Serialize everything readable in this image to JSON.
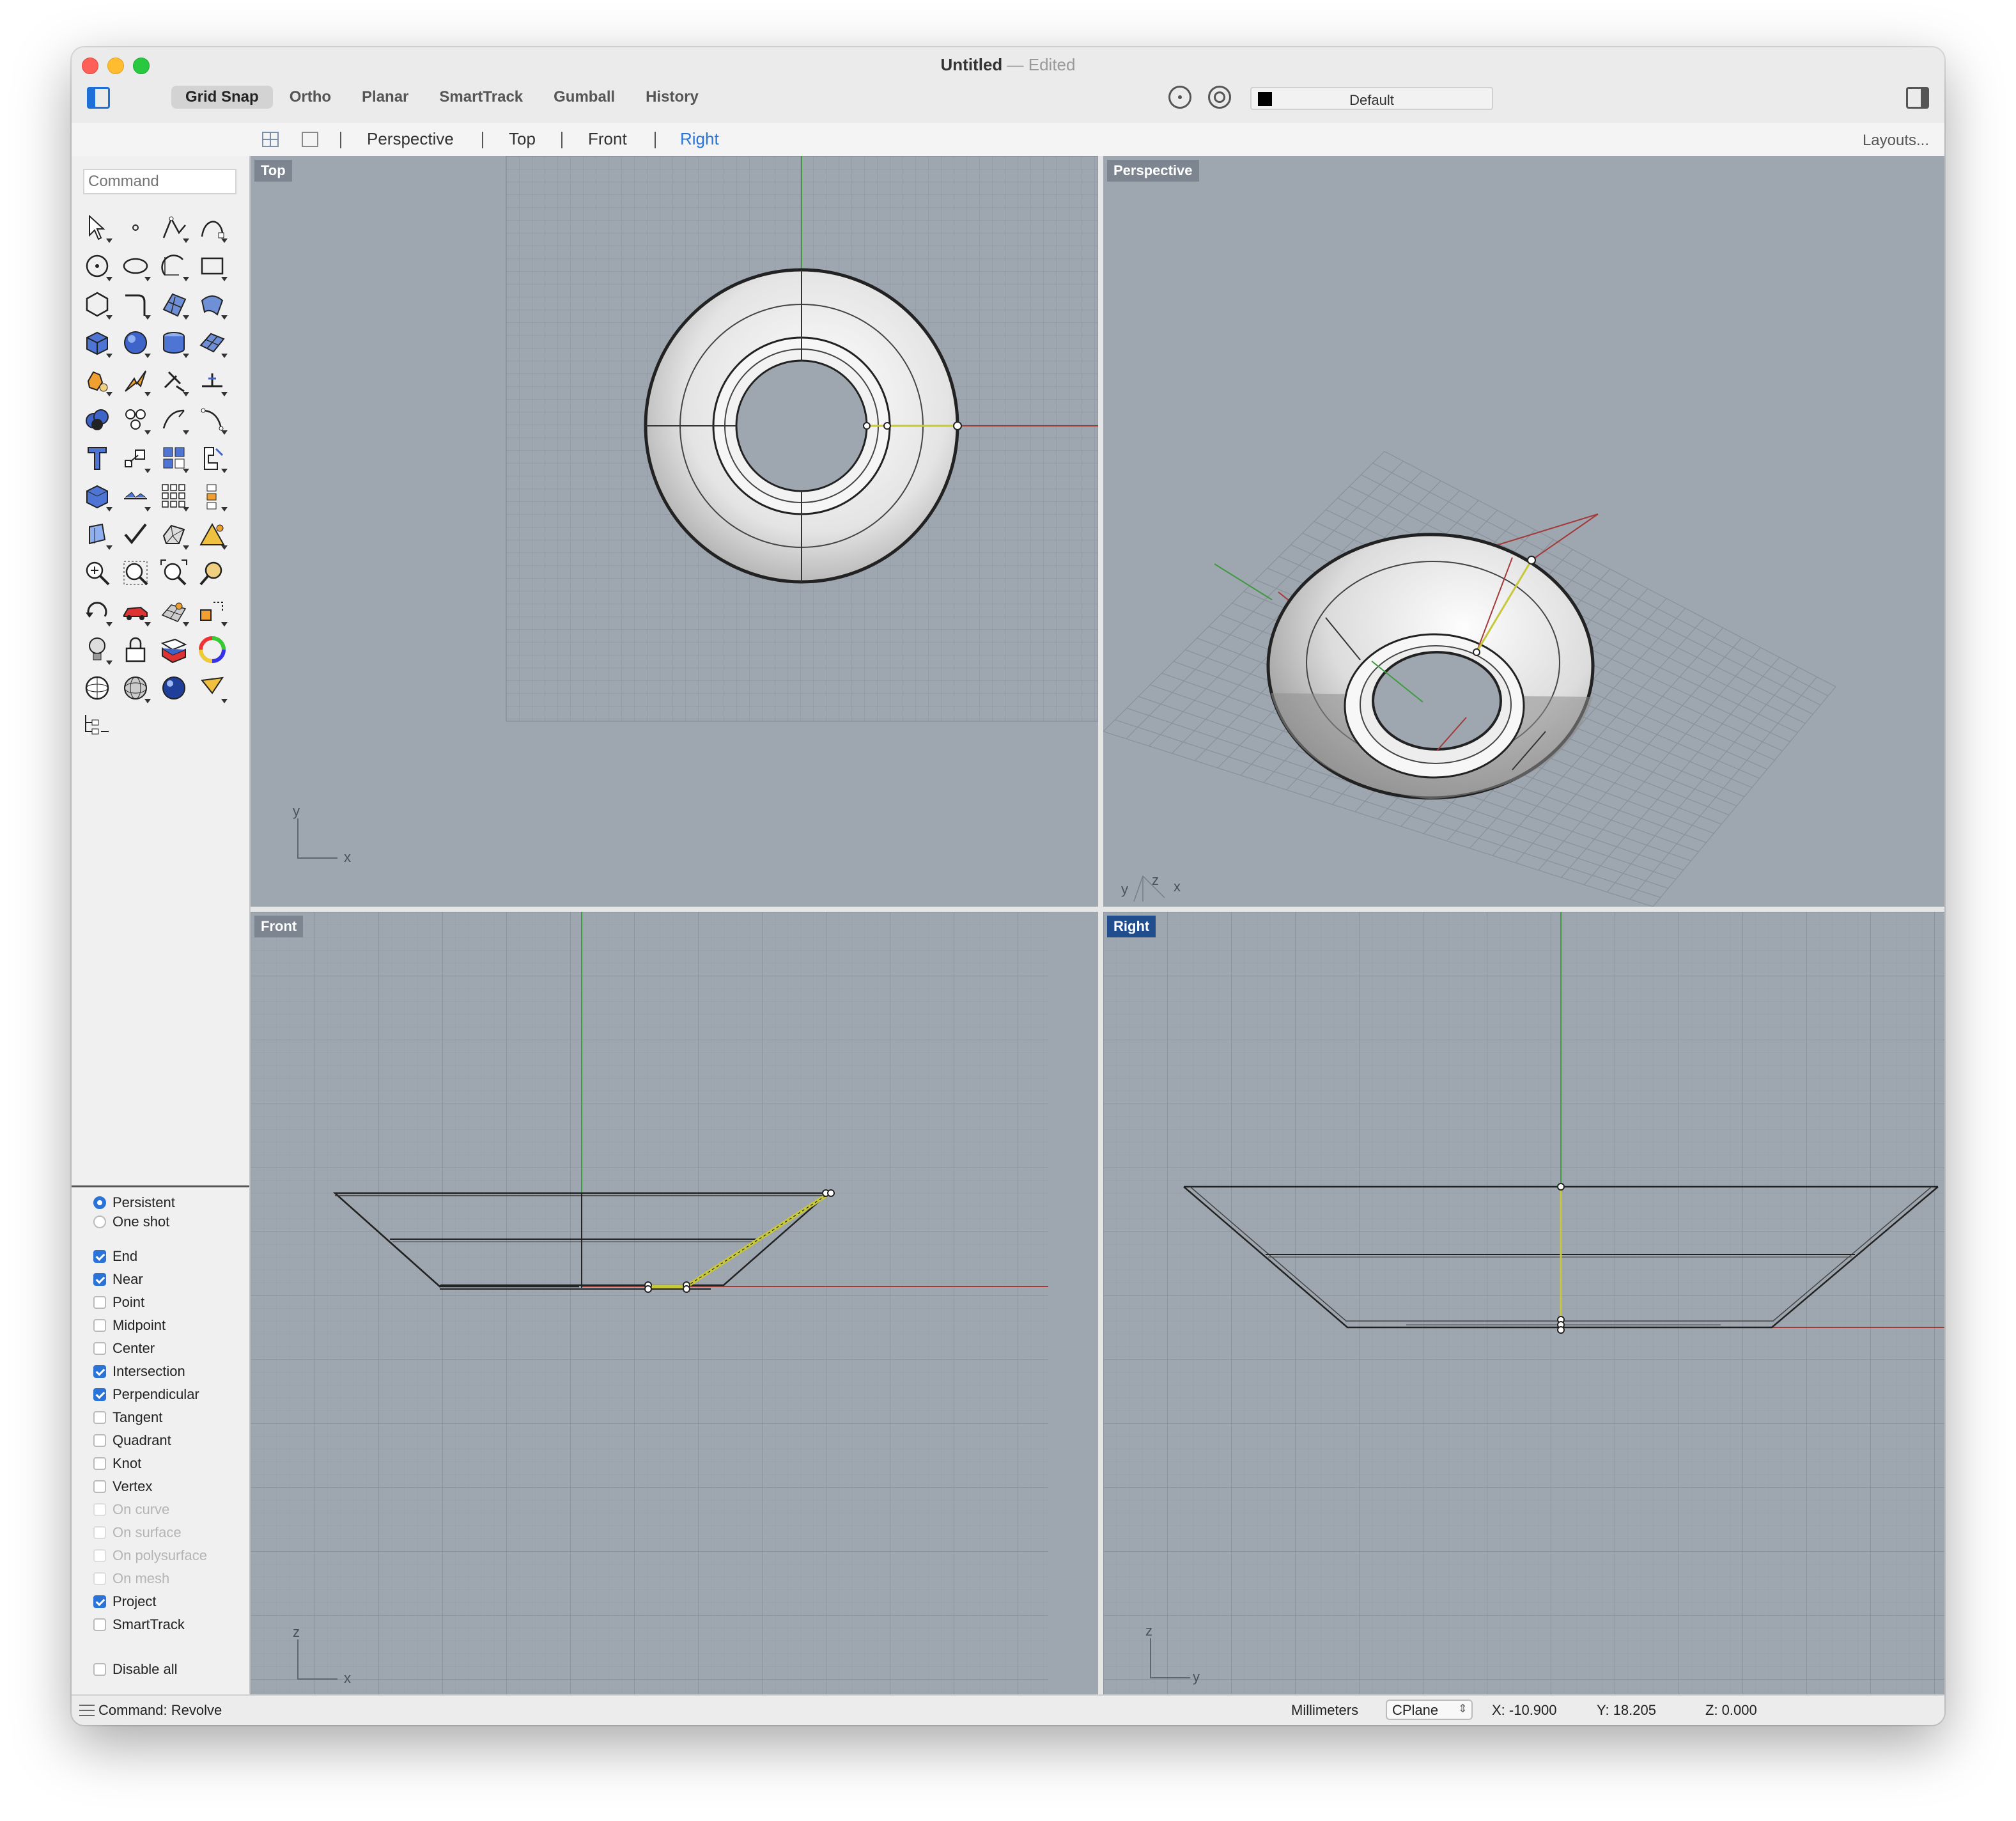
{
  "window": {
    "title": "Untitled",
    "separator": "—",
    "status": "Edited"
  },
  "toolbar": {
    "toggles": [
      "Grid Snap",
      "Ortho",
      "Planar",
      "SmartTrack",
      "Gumball",
      "History"
    ],
    "active_toggle": "Grid Snap",
    "layer": {
      "name": "Default",
      "color": "#000000"
    }
  },
  "viewport_tabs": {
    "tabs": [
      "Perspective",
      "Top",
      "Front",
      "Right"
    ],
    "active": "Right",
    "layouts_label": "Layouts..."
  },
  "command": {
    "placeholder": "Command"
  },
  "tools": [
    "select-arrow-icon",
    "point-icon",
    "polyline-icon",
    "curve-icon",
    "circle-icon",
    "ellipse-icon",
    "arc-icon",
    "rectangle-icon",
    "polygon-icon",
    "fillet-curve-icon",
    "surface-from-points-icon",
    "sweep-surface-icon",
    "box-icon",
    "sphere-icon",
    "cylinder-icon",
    "surface-plane-icon",
    "boolean-tools-icon",
    "explode-icon",
    "trim-icon",
    "split-icon",
    "boolean-union-icon",
    "group-icon",
    "rebuild-icon",
    "edit-points-icon",
    "text-icon",
    "scale-icon",
    "array-icon",
    "dimension-icon",
    "solid-tools-icon",
    "align-icon",
    "array-grid-icon",
    "distribute-icon",
    "analyze-icon",
    "check-icon",
    "mesh-icon",
    "render-tools-icon",
    "zoom-icon",
    "zoom-window-icon",
    "zoom-extents-icon",
    "zoom-selected-icon",
    "rotate-view-icon",
    "car-model-icon",
    "grid-icon",
    "transform-icon",
    "light-icon",
    "lock-icon",
    "layer-icon",
    "color-wheel-icon",
    "shaded-sphere-icon",
    "wireframe-sphere-icon",
    "render-sphere-icon",
    "pointer-icon",
    "named-view-icon"
  ],
  "osnap": {
    "mode": {
      "options": [
        "Persistent",
        "One shot"
      ],
      "selected": "Persistent"
    },
    "items": [
      {
        "label": "End",
        "checked": true,
        "enabled": true
      },
      {
        "label": "Near",
        "checked": true,
        "enabled": true
      },
      {
        "label": "Point",
        "checked": false,
        "enabled": true
      },
      {
        "label": "Midpoint",
        "checked": false,
        "enabled": true
      },
      {
        "label": "Center",
        "checked": false,
        "enabled": true
      },
      {
        "label": "Intersection",
        "checked": true,
        "enabled": true
      },
      {
        "label": "Perpendicular",
        "checked": true,
        "enabled": true
      },
      {
        "label": "Tangent",
        "checked": false,
        "enabled": true
      },
      {
        "label": "Quadrant",
        "checked": false,
        "enabled": true
      },
      {
        "label": "Knot",
        "checked": false,
        "enabled": true
      },
      {
        "label": "Vertex",
        "checked": false,
        "enabled": true
      },
      {
        "label": "On curve",
        "checked": false,
        "enabled": false
      },
      {
        "label": "On surface",
        "checked": false,
        "enabled": false
      },
      {
        "label": "On polysurface",
        "checked": false,
        "enabled": false
      },
      {
        "label": "On mesh",
        "checked": false,
        "enabled": false
      },
      {
        "label": "Project",
        "checked": true,
        "enabled": true
      },
      {
        "label": "SmartTrack",
        "checked": false,
        "enabled": true
      }
    ],
    "disable_all": {
      "label": "Disable all",
      "checked": false
    }
  },
  "viewports": {
    "top": {
      "label": "Top",
      "axes": [
        "y",
        "x"
      ]
    },
    "perspective": {
      "label": "Perspective",
      "axes": [
        "y",
        "z",
        "x"
      ]
    },
    "front": {
      "label": "Front",
      "axes": [
        "z",
        "x"
      ]
    },
    "right": {
      "label": "Right",
      "axes": [
        "z",
        "y"
      ],
      "active": true
    }
  },
  "status": {
    "command": "Command: Revolve",
    "units": "Millimeters",
    "cplane": "CPlane",
    "x": "X: -10.900",
    "y": "Y: 18.205",
    "z": "Z: 0.000"
  },
  "colors": {
    "viewport_bg": "#9ea6b0",
    "grid_line": "#8f97a1",
    "x_axis": "#a33a3a",
    "y_axis": "#3f9a3f",
    "selection": "#c7c73a",
    "accent": "#2a74d9"
  }
}
